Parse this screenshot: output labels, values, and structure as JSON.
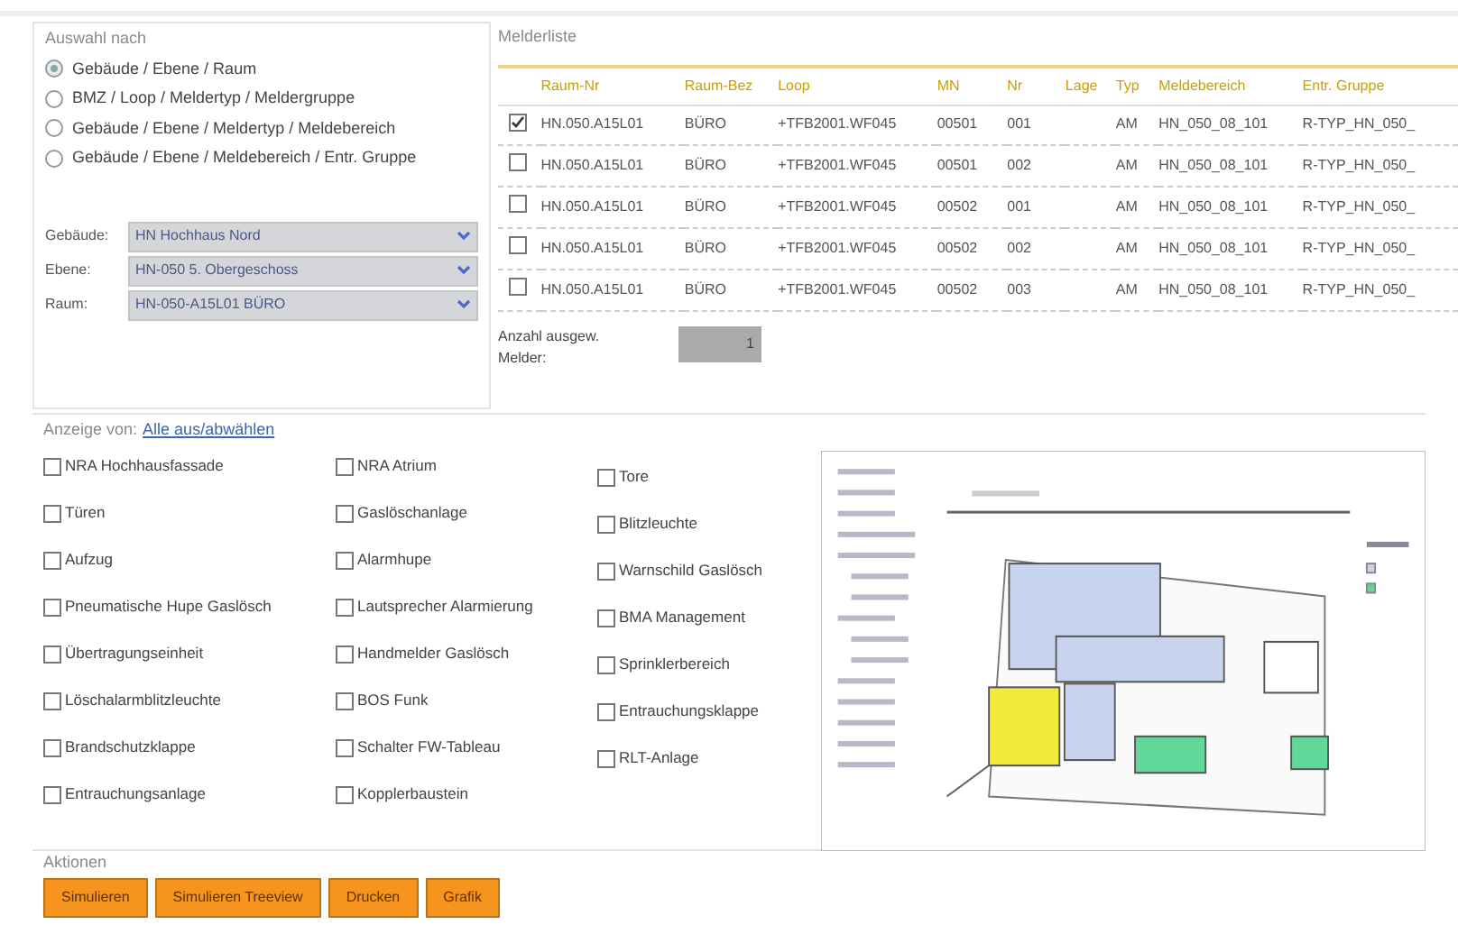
{
  "auswahl": {
    "legend": "Auswahl nach",
    "options": [
      {
        "label": "Gebäude / Ebene / Raum",
        "selected": true
      },
      {
        "label": "BMZ / Loop / Meldertyp / Meldergruppe",
        "selected": false
      },
      {
        "label": "Gebäude / Ebene / Meldertyp / Meldebereich",
        "selected": false
      },
      {
        "label": "Gebäude / Ebene / Meldebereich / Entr. Gruppe",
        "selected": false
      }
    ],
    "selects": [
      {
        "label": "Gebäude:",
        "value": "HN Hochhaus Nord"
      },
      {
        "label": "Ebene:",
        "value": "HN-050 5. Obergeschoss"
      },
      {
        "label": "Raum:",
        "value": "HN-050-A15L01 BÜRO"
      }
    ]
  },
  "melderliste": {
    "legend": "Melderliste",
    "columns": [
      "Raum-Nr",
      "Raum-Bez",
      "Loop",
      "MN",
      "Nr",
      "Lage",
      "Typ",
      "Meldebereich",
      "Entr. Gruppe"
    ],
    "rows": [
      {
        "checked": true,
        "cells": [
          "HN.050.A15L01",
          "BÜRO",
          "+TFB2001.WF045",
          "00501",
          "001",
          "",
          "AM",
          "HN_050_08_101",
          "R-TYP_HN_050_"
        ]
      },
      {
        "checked": false,
        "cells": [
          "HN.050.A15L01",
          "BÜRO",
          "+TFB2001.WF045",
          "00501",
          "002",
          "",
          "AM",
          "HN_050_08_101",
          "R-TYP_HN_050_"
        ]
      },
      {
        "checked": false,
        "cells": [
          "HN.050.A15L01",
          "BÜRO",
          "+TFB2001.WF045",
          "00502",
          "001",
          "",
          "AM",
          "HN_050_08_101",
          "R-TYP_HN_050_"
        ]
      },
      {
        "checked": false,
        "cells": [
          "HN.050.A15L01",
          "BÜRO",
          "+TFB2001.WF045",
          "00502",
          "002",
          "",
          "AM",
          "HN_050_08_101",
          "R-TYP_HN_050_"
        ]
      },
      {
        "checked": false,
        "cells": [
          "HN.050.A15L01",
          "BÜRO",
          "+TFB2001.WF045",
          "00502",
          "003",
          "",
          "AM",
          "HN_050_08_101",
          "R-TYP_HN_050_"
        ]
      }
    ],
    "count_label": "Anzahl ausgew. Melder:",
    "count_value": "1"
  },
  "anzeige": {
    "legend": "Anzeige von:",
    "link": "Alle aus/abwählen",
    "columns": [
      [
        {
          "label": "NRA Hochhausfassade",
          "checked": false
        },
        {
          "label": "Türen",
          "checked": false
        },
        {
          "label": "Aufzug",
          "checked": false
        },
        {
          "label": "Pneumatische Hupe Gaslösch",
          "checked": false
        },
        {
          "label": "Übertragungseinheit",
          "checked": false
        },
        {
          "label": "Löschalarmblitzleuchte",
          "checked": false
        },
        {
          "label": "Brandschutzklappe",
          "checked": false
        },
        {
          "label": "Entrauchungsanlage",
          "checked": false
        }
      ],
      [
        {
          "label": "NRA Atrium",
          "checked": false
        },
        {
          "label": "Gaslöschanlage",
          "checked": false
        },
        {
          "label": "Alarmhupe",
          "checked": false
        },
        {
          "label": "Lautsprecher Alarmierung",
          "checked": false
        },
        {
          "label": "Handmelder Gaslösch",
          "checked": false
        },
        {
          "label": "BOS Funk",
          "checked": false
        },
        {
          "label": "Schalter FW-Tableau",
          "checked": false
        },
        {
          "label": "Kopplerbaustein",
          "checked": false
        }
      ],
      [
        {
          "label": "Tore",
          "checked": false
        },
        {
          "label": "Blitzleuchte",
          "checked": false
        },
        {
          "label": "Warnschild Gaslösch",
          "checked": false
        },
        {
          "label": "BMA Management",
          "checked": false
        },
        {
          "label": "Sprinklerbereich",
          "checked": false
        },
        {
          "label": "Entrauchungsklappe",
          "checked": false
        },
        {
          "label": "RLT-Anlage",
          "checked": false
        }
      ]
    ]
  },
  "aktionen": {
    "legend": "Aktionen",
    "buttons": [
      "Simulieren",
      "Simulieren Treeview",
      "Drucken",
      "Grafik"
    ]
  }
}
